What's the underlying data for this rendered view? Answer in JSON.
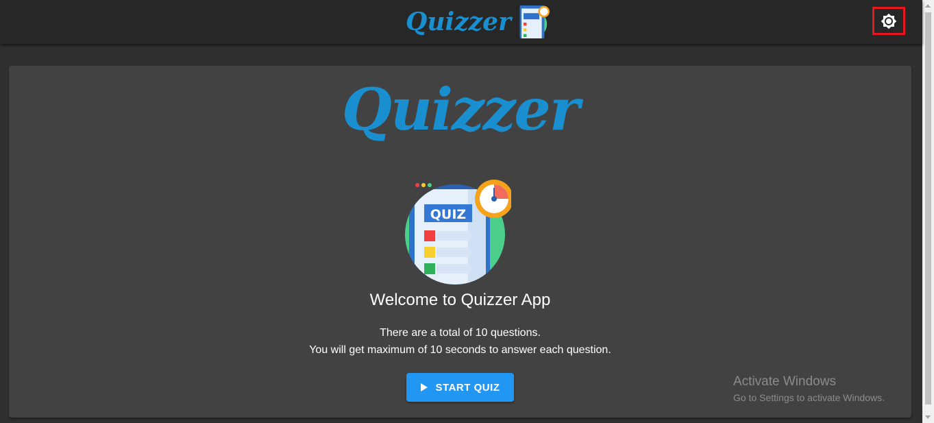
{
  "appbar": {
    "brand": "Quizzer",
    "theme_toggle_icon": "brightness-icon"
  },
  "card": {
    "logo_text": "Quizzer",
    "image_label": "QUIZ",
    "welcome": "Welcome to Quizzer App",
    "info_line1": "There are a total of 10 questions.",
    "info_line2": "You will get maximum of 10 seconds to answer each question.",
    "start_button": "START QUIZ"
  },
  "watermark": {
    "title": "Activate Windows",
    "subtitle": "Go to Settings to activate Windows."
  },
  "colors": {
    "accent": "#2196f3",
    "brand": "#1a8fd0",
    "highlight_border": "#e8171f"
  }
}
